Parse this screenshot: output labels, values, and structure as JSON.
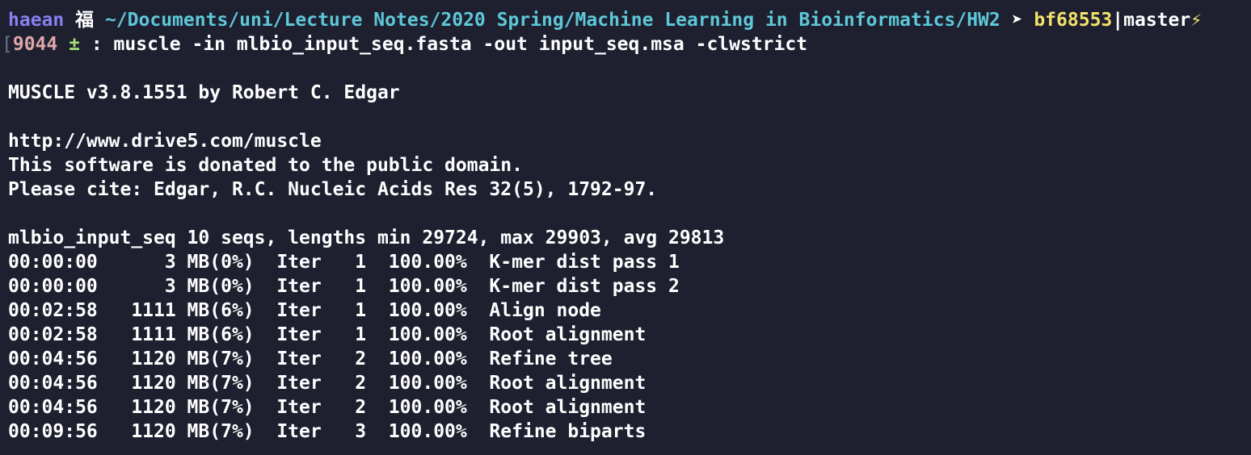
{
  "prompt": {
    "user": "haean",
    "glyph": "福",
    "path": "~/Documents/uni/Lecture Notes/2020 Spring/Machine Learning in Bioinformatics/HW2",
    "arrow": "➤",
    "commit": "bf68553",
    "separator": "|",
    "branch": "master",
    "bolt_icon": "⚡",
    "bracket": "[",
    "history_number": "9044",
    "plus_minus": "±",
    "colon": ":",
    "command": "muscle -in mlbio_input_seq.fasta -out input_seq.msa -clwstrict"
  },
  "output": {
    "banner": "MUSCLE v3.8.1551 by Robert C. Edgar",
    "url": "http://www.drive5.com/muscle",
    "donated": "This software is donated to the public domain.",
    "cite": "Please cite: Edgar, R.C. Nucleic Acids Res 32(5), 1792-97.",
    "summary": "mlbio_input_seq 10 seqs, lengths min 29724, max 29903, avg 29813",
    "progress_lines": [
      "00:00:00      3 MB(0%)  Iter   1  100.00%  K-mer dist pass 1",
      "00:00:00      3 MB(0%)  Iter   1  100.00%  K-mer dist pass 2",
      "00:02:58   1111 MB(6%)  Iter   1  100.00%  Align node",
      "00:02:58   1111 MB(6%)  Iter   1  100.00%  Root alignment",
      "00:04:56   1120 MB(7%)  Iter   2  100.00%  Refine tree",
      "00:04:56   1120 MB(7%)  Iter   2  100.00%  Root alignment",
      "00:04:56   1120 MB(7%)  Iter   2  100.00%  Root alignment",
      "00:09:56   1120 MB(7%)  Iter   3  100.00%  Refine biparts"
    ]
  },
  "colors": {
    "background": "#1e2030",
    "user": "#8a7ff0",
    "path": "#5ec8d8",
    "commit": "#f4e36a",
    "history_number": "#e0a8a8",
    "plus_minus": "#a6e07a"
  }
}
